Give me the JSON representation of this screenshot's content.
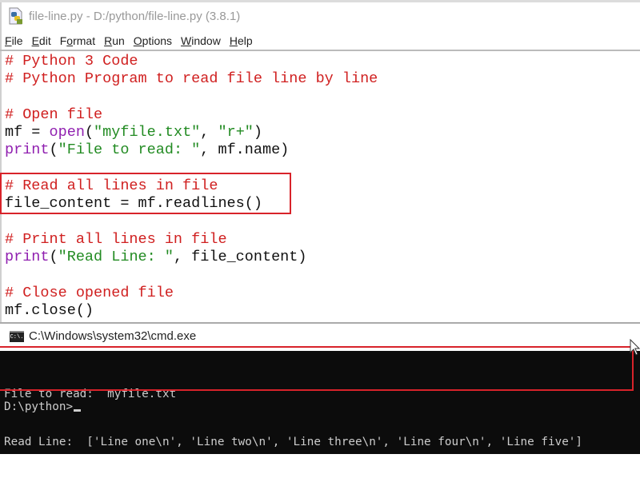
{
  "idle": {
    "title": "file-line.py - D:/python/file-line.py (3.8.1)",
    "menu": [
      {
        "label": "File",
        "mnemonic": "F",
        "rest": "ile"
      },
      {
        "label": "Edit",
        "mnemonic": "E",
        "rest": "dit"
      },
      {
        "label": "Format",
        "pre": "F",
        "mnemonic": "o",
        "rest": "rmat"
      },
      {
        "label": "Run",
        "mnemonic": "R",
        "rest": "un"
      },
      {
        "label": "Options",
        "mnemonic": "O",
        "rest": "ptions"
      },
      {
        "label": "Window",
        "mnemonic": "W",
        "rest": "indow"
      },
      {
        "label": "Help",
        "mnemonic": "H",
        "rest": "elp"
      }
    ],
    "code": [
      [
        {
          "t": "cm",
          "v": "# Python 3 Code"
        }
      ],
      [
        {
          "t": "cm",
          "v": "# Python Program to read file line by line"
        }
      ],
      [],
      [
        {
          "t": "cm",
          "v": "# Open file"
        }
      ],
      [
        {
          "t": "tx",
          "v": "mf = "
        },
        {
          "t": "kw",
          "v": "open"
        },
        {
          "t": "tx",
          "v": "("
        },
        {
          "t": "st",
          "v": "\"myfile.txt\""
        },
        {
          "t": "tx",
          "v": ", "
        },
        {
          "t": "st",
          "v": "\"r+\""
        },
        {
          "t": "tx",
          "v": ")"
        }
      ],
      [
        {
          "t": "kw",
          "v": "print"
        },
        {
          "t": "tx",
          "v": "("
        },
        {
          "t": "st",
          "v": "\"File to read: \""
        },
        {
          "t": "tx",
          "v": ", mf.name)"
        }
      ],
      [],
      [
        {
          "t": "cm",
          "v": "# Read all lines in file"
        }
      ],
      [
        {
          "t": "tx",
          "v": "file_content = mf.readlines()"
        }
      ],
      [],
      [
        {
          "t": "cm",
          "v": "# Print all lines in file"
        }
      ],
      [
        {
          "t": "kw",
          "v": "print"
        },
        {
          "t": "tx",
          "v": "("
        },
        {
          "t": "st",
          "v": "\"Read Line: \""
        },
        {
          "t": "tx",
          "v": ", file_content)"
        }
      ],
      [],
      [
        {
          "t": "cm",
          "v": "# Close opened file"
        }
      ],
      [
        {
          "t": "tx",
          "v": "mf.close()"
        }
      ]
    ]
  },
  "cmd": {
    "title": "C:\\Windows\\system32\\cmd.exe",
    "icon_label": "C:\\.",
    "output": [
      "File to read:  myfile.txt",
      "Read Line:  ['Line one\\n', 'Line two\\n', 'Line three\\n', 'Line four\\n', 'Line five']"
    ],
    "prompt": "D:\\python>"
  },
  "colors": {
    "comment": "#d02020",
    "keyword": "#9020b0",
    "string": "#228b22",
    "highlight": "#d8232a",
    "console_bg": "#0c0c0c",
    "console_fg": "#cccccc"
  }
}
